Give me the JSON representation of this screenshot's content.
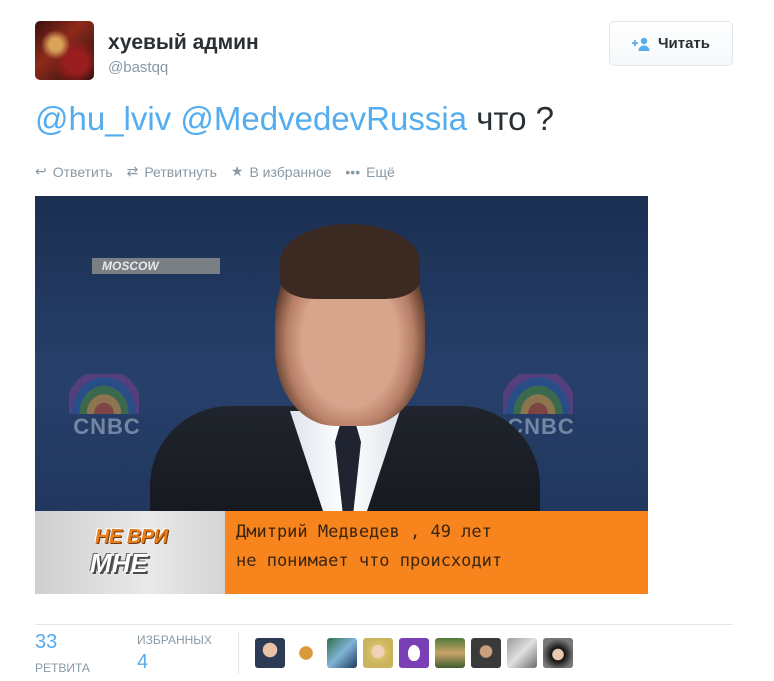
{
  "tweet": {
    "author_name": "хуевый админ",
    "author_handle": "@bastqq",
    "follow_label": "Читать",
    "mention1": "@hu_lviv",
    "mention2": "@MedvedevRussia",
    "text_rest": "что ?"
  },
  "actions": {
    "reply": "Ответить",
    "retweet": "Ретвитнуть",
    "favorite": "В избранное",
    "more": "Ещё"
  },
  "media": {
    "location_tag": "MOSCOW",
    "channel_left": "CNBC",
    "channel_right": "CNBC",
    "show_logo_line1": "НЕ ВРИ",
    "show_logo_line2": "МНЕ",
    "caption_line1": "Дмитрий Медведев , 49 лет",
    "caption_line2": "не понимает что происходит"
  },
  "stats": {
    "retweets_count": "33",
    "retweets_label": "РЕТВИТА",
    "favorites_count": "4",
    "favorites_label": "ИЗБРАННЫХ"
  },
  "colors": {
    "link": "#55acee",
    "muted": "#8899a6",
    "text": "#292f33",
    "banner_orange": "#f7841c"
  },
  "favoriters": [
    "user-avatar",
    "user-avatar",
    "user-avatar",
    "user-avatar",
    "egg-avatar",
    "user-avatar",
    "user-avatar",
    "user-avatar",
    "user-avatar"
  ]
}
